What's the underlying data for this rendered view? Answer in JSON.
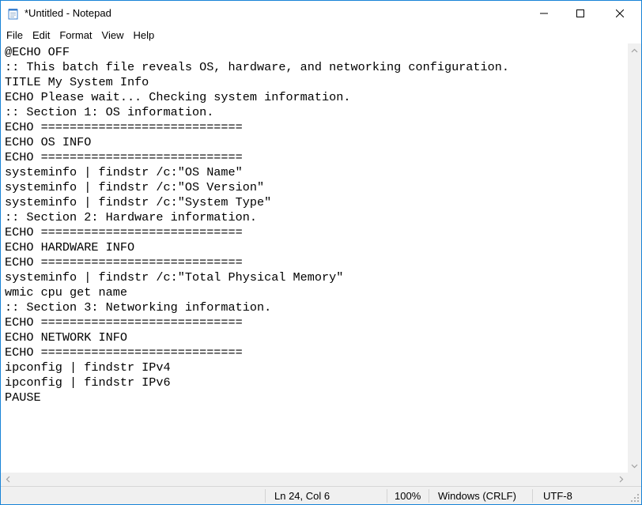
{
  "window": {
    "title": "*Untitled - Notepad",
    "controls": {
      "minimize": "minimize-icon",
      "maximize": "maximize-icon",
      "close": "close-icon"
    }
  },
  "menu": [
    {
      "label": "File"
    },
    {
      "label": "Edit"
    },
    {
      "label": "Format"
    },
    {
      "label": "View"
    },
    {
      "label": "Help"
    }
  ],
  "editor": {
    "lines": [
      "@ECHO OFF",
      ":: This batch file reveals OS, hardware, and networking configuration.",
      "TITLE My System Info",
      "ECHO Please wait... Checking system information.",
      ":: Section 1: OS information.",
      "ECHO ============================",
      "ECHO OS INFO",
      "ECHO ============================",
      "systeminfo | findstr /c:\"OS Name\"",
      "systeminfo | findstr /c:\"OS Version\"",
      "systeminfo | findstr /c:\"System Type\"",
      ":: Section 2: Hardware information.",
      "ECHO ============================",
      "ECHO HARDWARE INFO",
      "ECHO ============================",
      "systeminfo | findstr /c:\"Total Physical Memory\"",
      "wmic cpu get name",
      ":: Section 3: Networking information.",
      "ECHO ============================",
      "ECHO NETWORK INFO",
      "ECHO ============================",
      "ipconfig | findstr IPv4",
      "ipconfig | findstr IPv6",
      "PAUSE"
    ]
  },
  "status": {
    "position": "Ln 24, Col 6",
    "zoom": "100%",
    "line_ending": "Windows (CRLF)",
    "encoding": "UTF-8"
  },
  "colors": {
    "window_border": "#1883d7",
    "chrome": "#f0f0f0"
  }
}
